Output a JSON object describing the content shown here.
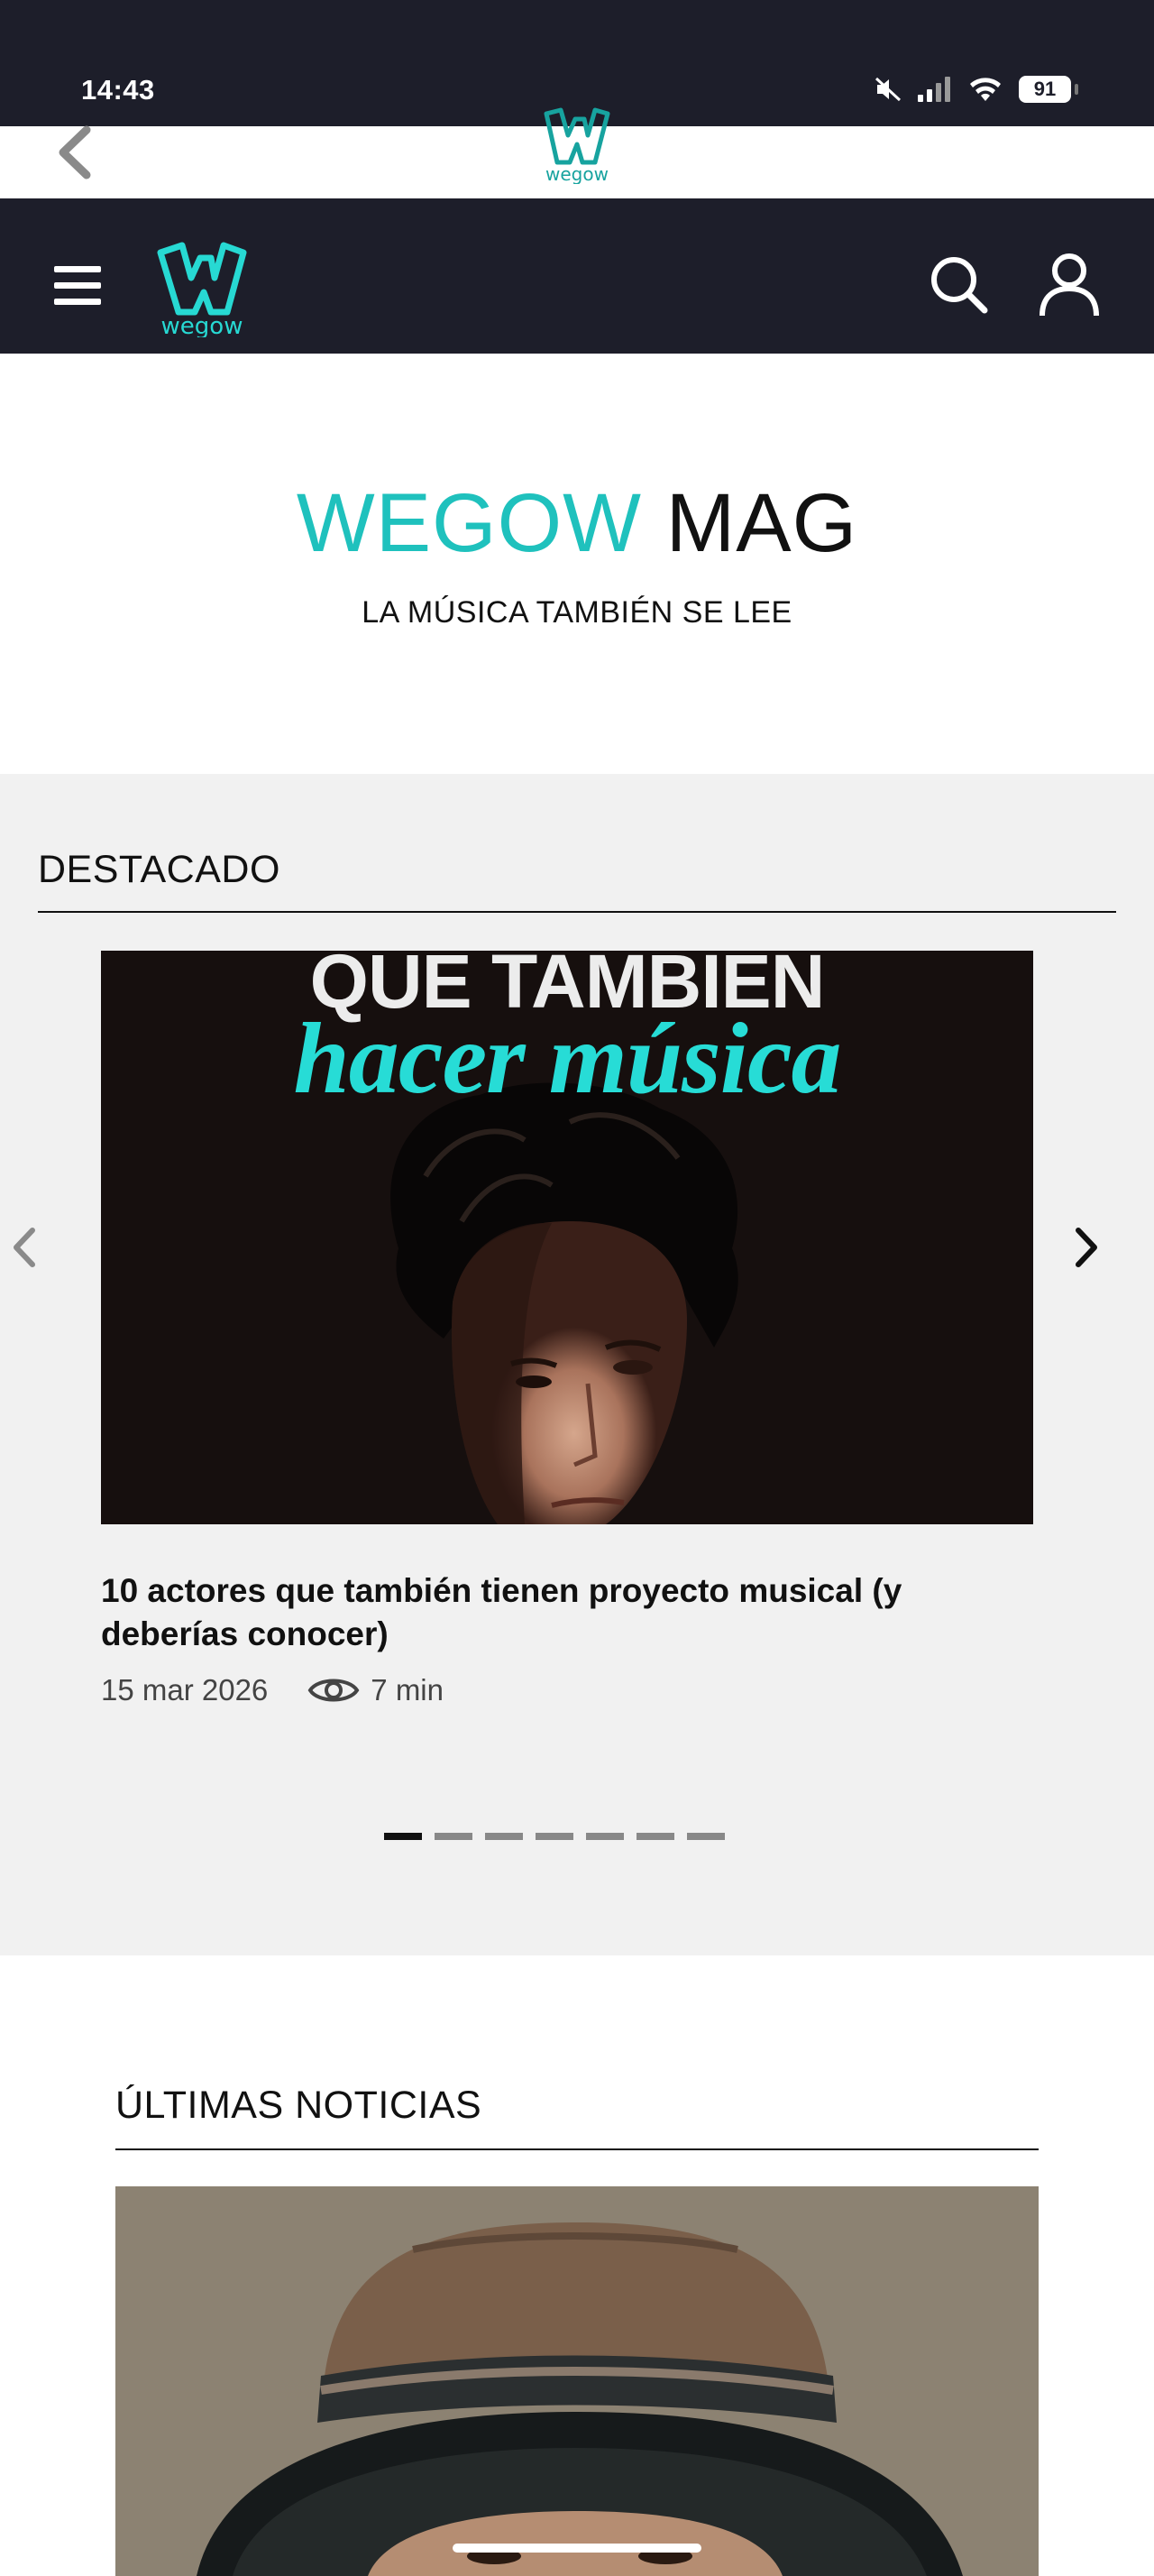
{
  "status_bar": {
    "time": "14:43",
    "battery": "91",
    "icons": [
      "mute-icon",
      "signal-icon",
      "wifi-icon",
      "battery-icon"
    ]
  },
  "browser": {
    "back_icon": "chevron-left-icon",
    "logo_text": "wegow"
  },
  "app_bar": {
    "logo_text": "wegow",
    "icons": [
      "menu-icon",
      "search-icon",
      "user-icon"
    ]
  },
  "mag_header": {
    "title_accent": "WEGOW",
    "title_plain": "MAG",
    "subtitle": "LA MÚSICA TAMBIÉN SE LEE"
  },
  "featured": {
    "section_title": "DESTACADO",
    "image_text_line1": "QUE TAMBIEN",
    "image_text_line2": "hacer música",
    "article_title": "10 actores que también tienen proyecto musical (y deberías conocer)",
    "date": "15 mar 2026",
    "read_time": "7 min",
    "dots_count": 7,
    "active_dot": 0
  },
  "latest": {
    "section_title": "ÚLTIMAS NOTICIAS"
  },
  "colors": {
    "dark_bar": "#1d1e2a",
    "accent": "#1fc1bd",
    "featured_bg": "#f1f1f1"
  }
}
